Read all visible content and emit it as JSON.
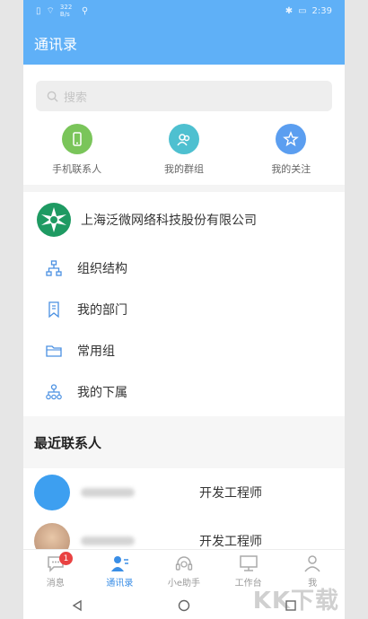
{
  "statusbar": {
    "time": "2:39",
    "speed": "322 B/s"
  },
  "header": {
    "title": "通讯录"
  },
  "search": {
    "placeholder": "搜索"
  },
  "quick_actions": [
    {
      "label": "手机联系人",
      "icon": "phone-icon",
      "color": "#7ac55a"
    },
    {
      "label": "我的群组",
      "icon": "group-icon",
      "color": "#4ec0d0"
    },
    {
      "label": "我的关注",
      "icon": "star-icon",
      "color": "#5b9ef0"
    }
  ],
  "company": {
    "name": "上海泛微网络科技股份有限公司"
  },
  "menu": [
    {
      "label": "组织结构",
      "icon": "org-structure-icon"
    },
    {
      "label": "我的部门",
      "icon": "bookmark-icon"
    },
    {
      "label": "常用组",
      "icon": "folder-icon"
    },
    {
      "label": "我的下属",
      "icon": "subordinates-icon"
    }
  ],
  "recent": {
    "title": "最近联系人",
    "contacts": [
      {
        "job": "开发工程师"
      },
      {
        "job": "开发工程师"
      }
    ]
  },
  "tabs": [
    {
      "label": "消息",
      "badge": "1"
    },
    {
      "label": "通讯录"
    },
    {
      "label": "小e助手"
    },
    {
      "label": "工作台"
    },
    {
      "label": "我"
    }
  ],
  "watermark": "KK下载",
  "colors": {
    "primary": "#5fb0f7",
    "active_tab": "#3a8ee6",
    "badge": "#e94242"
  }
}
